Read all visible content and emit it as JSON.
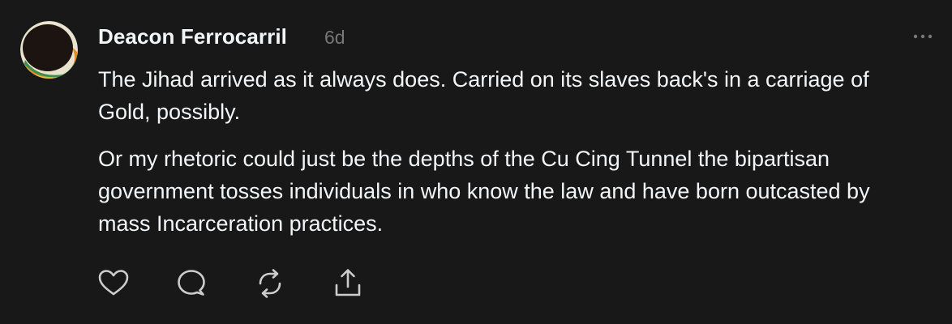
{
  "post": {
    "author": "Deacon Ferrocarril",
    "time": "6d",
    "paragraphs": [
      "The Jihad arrived as it always does. Carried on its slaves back's in a carriage of Gold, possibly.",
      "Or my rhetoric could just be the depths of the Cu Cing Tunnel the bipartisan government tosses individuals in who know the law and have born outcasted by mass Incarceration practices."
    ],
    "avatar_colors": [
      "#1c1410",
      "#e8e2cf",
      "#3f8f4a",
      "#e8892a",
      "#f0c040"
    ]
  },
  "actions": {
    "icons": [
      "heart-icon",
      "comment-icon",
      "repost-icon",
      "share-icon"
    ]
  },
  "menu": {
    "icon": "more-options-icon"
  },
  "theme": {
    "background": "#181818",
    "text": "#f3f5f7",
    "muted": "#777777",
    "icon": "#cccccc"
  }
}
